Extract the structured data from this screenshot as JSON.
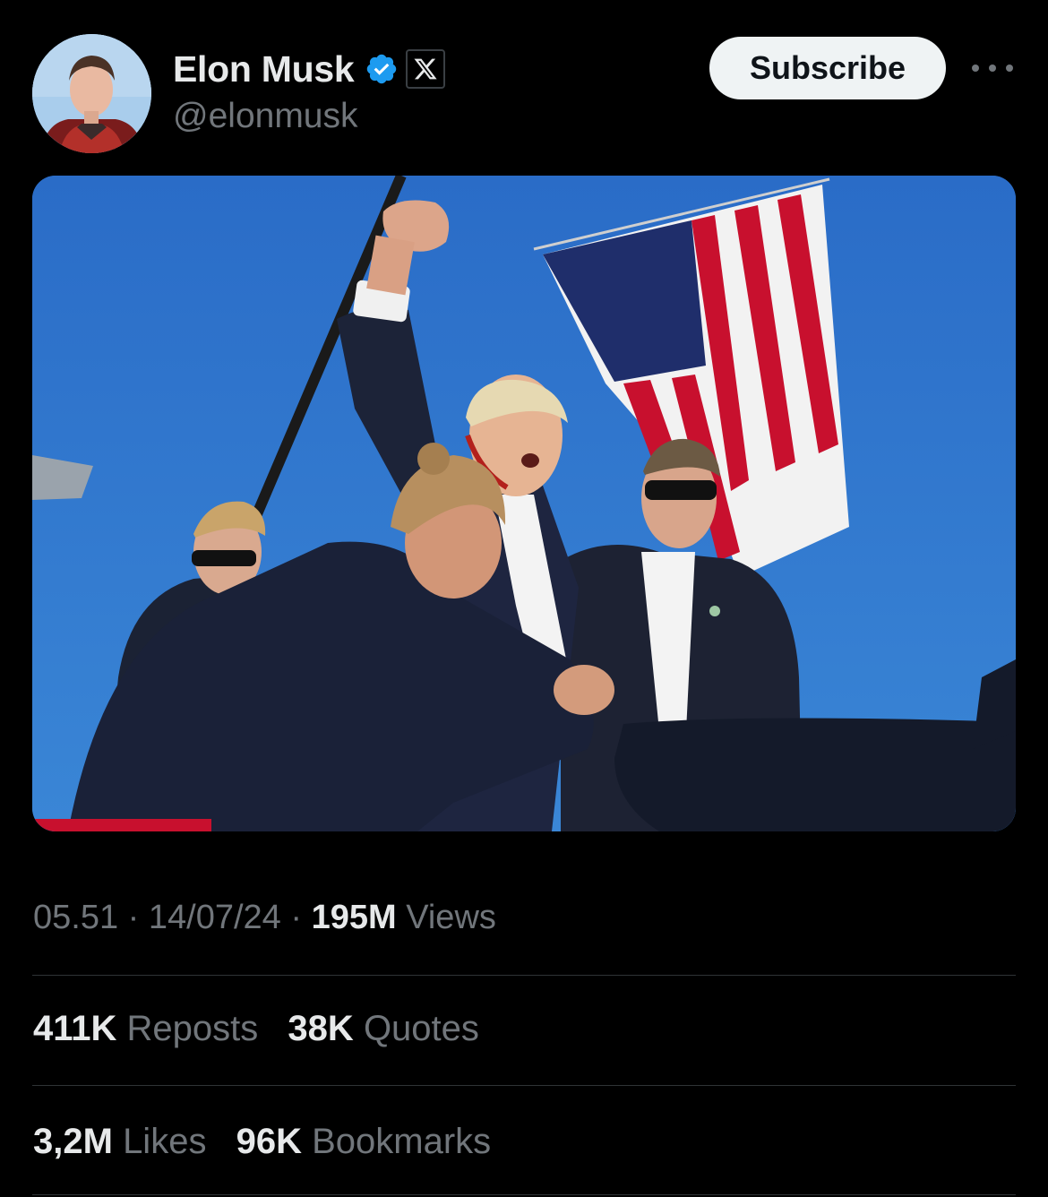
{
  "author": {
    "display_name": "Elon Musk",
    "handle": "@elonmusk",
    "verified_icon": "verified-badge-icon",
    "affiliate_icon": "x-logo-icon",
    "verified_color": "#1d9bf0"
  },
  "header": {
    "subscribe_label": "Subscribe",
    "more_icon": "more-dots-icon"
  },
  "media": {
    "type": "photo"
  },
  "meta": {
    "time": "05.51",
    "separator": "·",
    "date": "14/07/24",
    "views_count": "195M",
    "views_label": "Views"
  },
  "stats": {
    "reposts_count": "411K",
    "reposts_label": "Reposts",
    "quotes_count": "38K",
    "quotes_label": "Quotes",
    "likes_count": "3,2M",
    "likes_label": "Likes",
    "bookmarks_count": "96K",
    "bookmarks_label": "Bookmarks"
  },
  "colors": {
    "background": "#000000",
    "primary_text": "#e7e9ea",
    "secondary_text": "#71767b",
    "divider": "#2f3336",
    "button_bg": "#eff3f4"
  }
}
